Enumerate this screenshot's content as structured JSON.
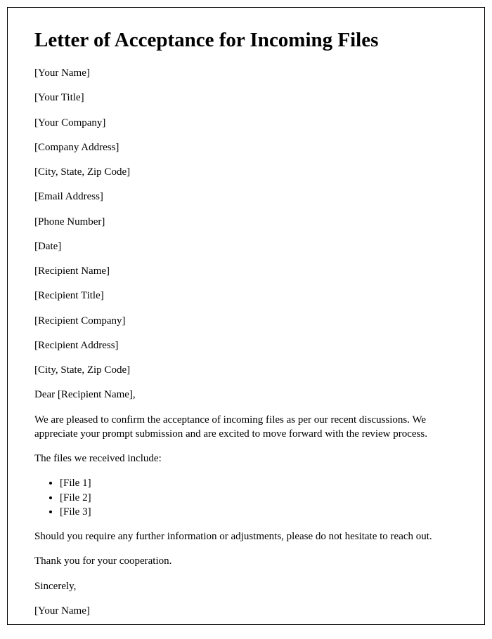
{
  "title": "Letter of Acceptance for Incoming Files",
  "sender": {
    "name": "[Your Name]",
    "title": "[Your Title]",
    "company": "[Your Company]",
    "address": "[Company Address]",
    "city_state_zip": "[City, State, Zip Code]",
    "email": "[Email Address]",
    "phone": "[Phone Number]"
  },
  "date": "[Date]",
  "recipient": {
    "name": "[Recipient Name]",
    "title": "[Recipient Title]",
    "company": "[Recipient Company]",
    "address": "[Recipient Address]",
    "city_state_zip": "[City, State, Zip Code]"
  },
  "salutation": "Dear [Recipient Name],",
  "body": {
    "para1": "We are pleased to confirm the acceptance of incoming files as per our recent discussions. We appreciate your prompt submission and are excited to move forward with the review process.",
    "para2": "The files we received include:",
    "files": [
      "[File 1]",
      "[File 2]",
      "[File 3]"
    ],
    "para3": "Should you require any further information or adjustments, please do not hesitate to reach out.",
    "para4": "Thank you for your cooperation."
  },
  "closing": "Sincerely,",
  "signature": "[Your Name]"
}
